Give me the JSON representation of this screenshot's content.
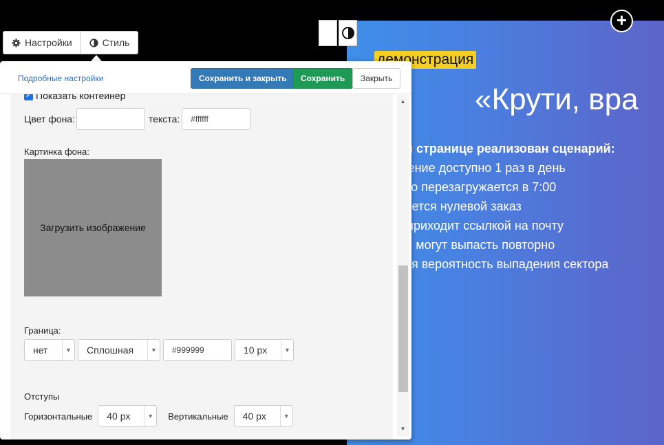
{
  "tabs": [
    {
      "label": "Настройки",
      "icon": "gear-icon"
    },
    {
      "label": "Стиль",
      "icon": "half-circle-icon"
    }
  ],
  "header": {
    "detail_link": "Подробные настройки",
    "save_close": "Сохранить и закрыть",
    "save": "Сохранить",
    "close": "Закрыть"
  },
  "form": {
    "show_container": "Показать контейнер",
    "bg_color_label": "Цвет фона:",
    "bg_color_value": "",
    "text_color_label": "текста:",
    "text_color_value": "#ffffff",
    "bg_image_label": "Картинка фона:",
    "upload_label": "Загрузить изображение",
    "border_label": "Граница:",
    "border_side": "нет",
    "border_style": "Сплошная",
    "border_color": "#999999",
    "border_width": "10 px",
    "padding_label": "Отступы",
    "horizontal_label": "Горизонтальные",
    "horizontal_value": "40 px",
    "vertical_label": "Вертикальные",
    "vertical_value": "40 px"
  },
  "preview": {
    "badge": "демонстрация",
    "title": "«Крути, вра",
    "heading": "ой странице реализован сценарий:",
    "items": [
      "щение доступно 1 раз в день",
      "есо перезагружается в 7:00",
      "дается нулевой заказ",
      "з приходит ссылкой на почту",
      "зы могут выпасть повторно",
      "ная вероятность выпадения сектора"
    ]
  },
  "colors": {
    "primary": "#337ab7",
    "success": "#1e9a56",
    "badge": "#f5cf21"
  }
}
